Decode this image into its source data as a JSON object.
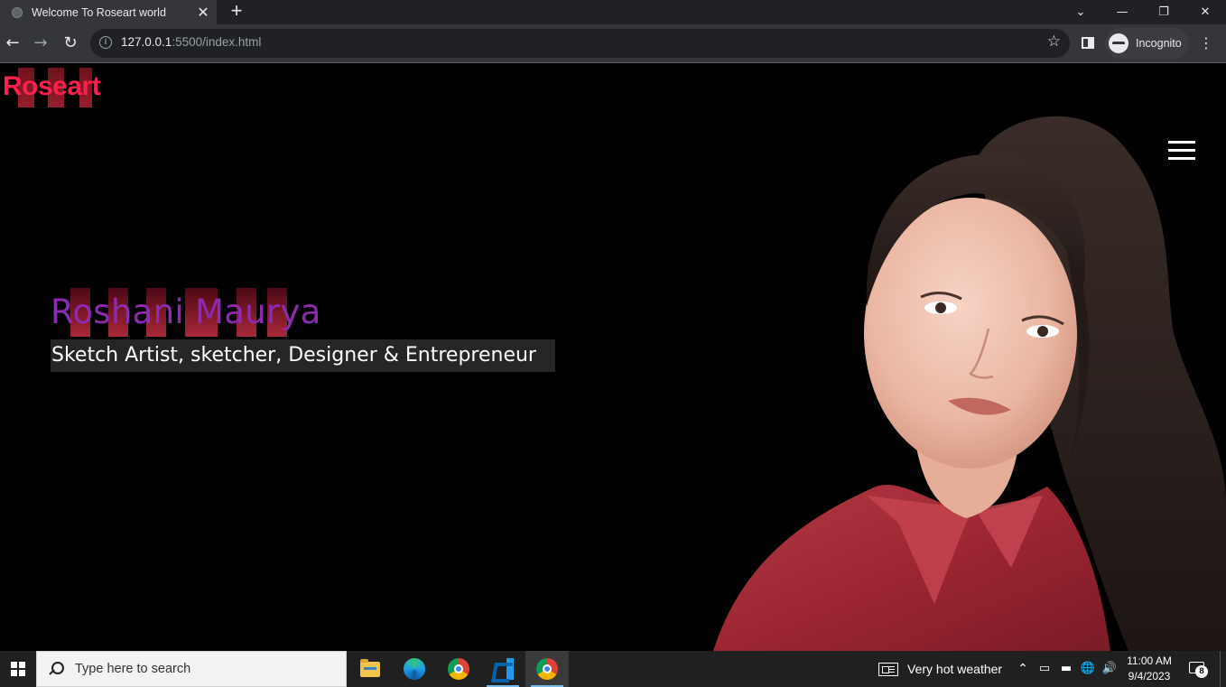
{
  "browser": {
    "tab_title": "Welcome To Roseart world",
    "tab_close": "✕",
    "new_tab": "+",
    "url_host": "127.0.0.1",
    "url_rest": ":5500/index.html",
    "profile_label": "Incognito",
    "window_controls": {
      "tab_search": "⌄",
      "minimize": "—",
      "restore": "❐",
      "close": "✕"
    },
    "nav": {
      "back": "←",
      "forward": "→",
      "reload": "↻",
      "info": "i",
      "star": "☆",
      "menu": "⋮"
    }
  },
  "page": {
    "logo": "Roseart",
    "hero_name": "Roshani Maurya",
    "tagline": "Sketch Artist, sketcher, Designer & Entrepreneur",
    "colors": {
      "logo": "#ff1f4d",
      "name": "#8e2bb0",
      "tagline_bg": "#262626"
    }
  },
  "taskbar": {
    "search_placeholder": "Type here to search",
    "pinned": [
      "file-explorer",
      "edge",
      "chrome",
      "vscode",
      "chrome-incognito"
    ],
    "weather": "Very hot weather",
    "time": "11:00 AM",
    "date": "9/4/2023",
    "notification_count": "8",
    "tray": {
      "chevron": "⌃",
      "net": "🌐",
      "volume": "🔊"
    }
  }
}
